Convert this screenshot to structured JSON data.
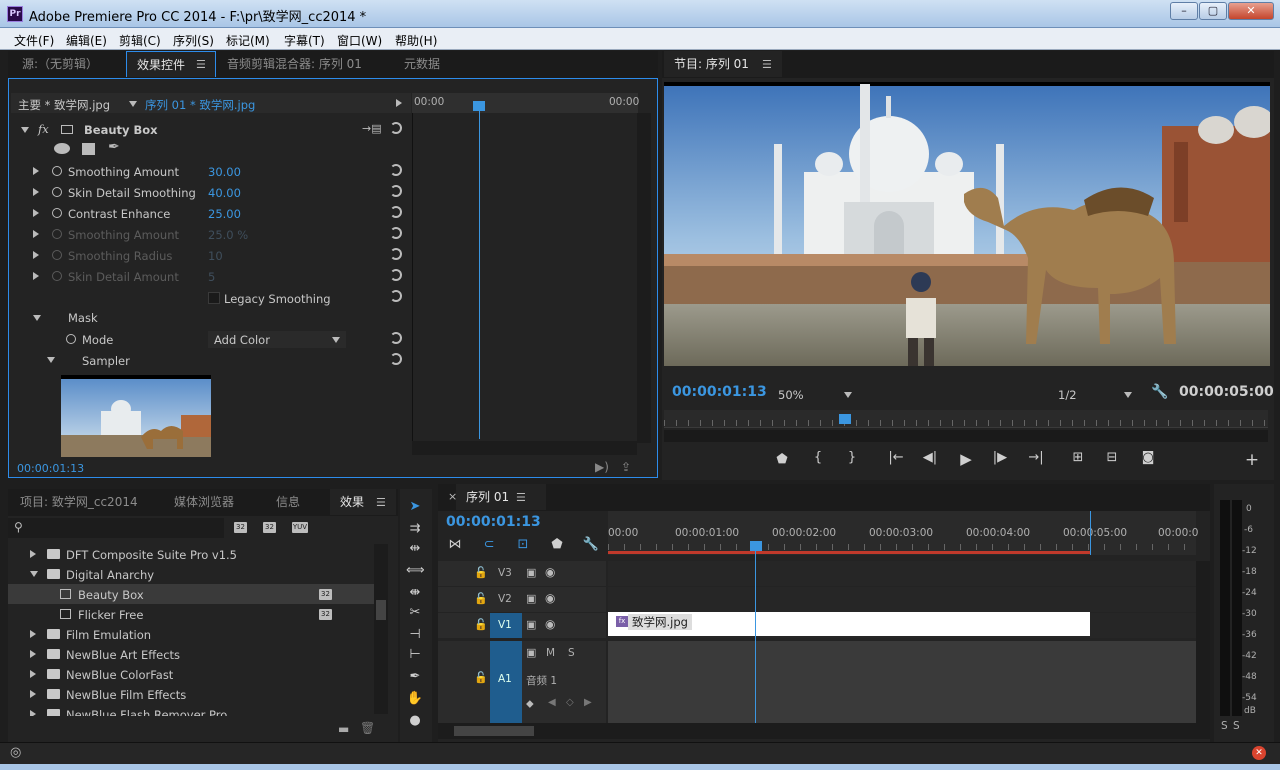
{
  "window": {
    "title": "Adobe Premiere Pro CC 2014 - F:\\pr\\致学网_cc2014 *",
    "app_badge": "Pr",
    "minimize": "–",
    "maximize": "▢",
    "close": "✕"
  },
  "menu": [
    "文件(F)",
    "编辑(E)",
    "剪辑(C)",
    "序列(S)",
    "标记(M)",
    "字幕(T)",
    "窗口(W)",
    "帮助(H)"
  ],
  "source_panel": {
    "tabs": [
      "源:（无剪辑）",
      "效果控件",
      "音频剪辑混合器: 序列 01",
      "元数据"
    ],
    "active_tab": "效果控件",
    "master_clip": "主要 * 致学网.jpg",
    "sequence_clip": "序列 01 * 致学网.jpg",
    "ruler_start": "00:00",
    "ruler_end": "00:00",
    "effect_name": "Beauty Box",
    "fx_label": "fx",
    "params": [
      {
        "name": "Smoothing Amount",
        "value": "30.00",
        "enabled": true
      },
      {
        "name": "Skin Detail Smoothing",
        "value": "40.00",
        "enabled": true
      },
      {
        "name": "Contrast Enhance",
        "value": "25.00",
        "enabled": true
      },
      {
        "name": "Smoothing Amount",
        "value": "25.0 %",
        "enabled": false
      },
      {
        "name": "Smoothing Radius",
        "value": "10",
        "enabled": false
      },
      {
        "name": "Skin Detail Amount",
        "value": "5",
        "enabled": false
      }
    ],
    "legacy_smoothing": "Legacy Smoothing",
    "mask_label": "Mask",
    "mode_label": "Mode",
    "mode_value": "Add Color",
    "sampler_label": "Sampler",
    "timecode": "00:00:01:13"
  },
  "program_monitor": {
    "tab": "节目: 序列 01",
    "timecode": "00:00:01:13",
    "zoom": "50%",
    "resolution": "1/2",
    "duration": "00:00:05:00",
    "playhead_fraction": 0.3,
    "controls": [
      "marker-icon",
      "in-point-icon",
      "out-point-icon",
      "go-to-in-icon",
      "step-back-icon",
      "play-icon",
      "step-forward-icon",
      "go-to-out-icon",
      "lift-icon",
      "extract-icon",
      "export-frame-icon"
    ]
  },
  "project_panel": {
    "tabs": [
      "项目: 致学网_cc2014",
      "媒体浏览器",
      "信息",
      "效果"
    ],
    "active_tab": "效果",
    "search_placeholder": "",
    "badges": [
      "32",
      "32",
      "YUV"
    ],
    "items": [
      {
        "label": "DFT Composite Suite Pro v1.5",
        "type": "folder",
        "expanded": false,
        "indent": 0
      },
      {
        "label": "Digital Anarchy",
        "type": "folder",
        "expanded": true,
        "indent": 0
      },
      {
        "label": "Beauty Box",
        "type": "effect",
        "indent": 1,
        "selected": true
      },
      {
        "label": "Flicker Free",
        "type": "effect",
        "indent": 1
      },
      {
        "label": "Film Emulation",
        "type": "folder",
        "expanded": false,
        "indent": 0
      },
      {
        "label": "NewBlue Art Effects",
        "type": "folder",
        "expanded": false,
        "indent": 0
      },
      {
        "label": "NewBlue ColorFast",
        "type": "folder",
        "expanded": false,
        "indent": 0
      },
      {
        "label": "NewBlue Film Effects",
        "type": "folder",
        "expanded": false,
        "indent": 0
      },
      {
        "label": "NewBlue Flash Remover Pro",
        "type": "folder",
        "expanded": false,
        "indent": 0
      }
    ]
  },
  "timeline": {
    "tab": "序列 01",
    "timecode": "00:00:01:13",
    "ruler": [
      "00:00",
      "00:00:01:00",
      "00:00:02:00",
      "00:00:03:00",
      "00:00:04:00",
      "00:00:05:00",
      "00:00:0"
    ],
    "tracks": {
      "v3": "V3",
      "v2": "V2",
      "v1": "V1",
      "a1": "A1",
      "a1_name": "音频 1",
      "mute": "M",
      "solo": "S"
    },
    "clip_name": "致学网.jpg"
  },
  "audio_meter": {
    "scale": [
      "0",
      "-6",
      "-12",
      "-18",
      "-24",
      "-30",
      "-36",
      "-42",
      "-48",
      "-54",
      "dB"
    ],
    "solo_labels": [
      "S",
      "S"
    ]
  },
  "colors": {
    "accent": "#2d8ceb",
    "timecode": "#3b96e0",
    "clip": "#ffffff",
    "track_select": "#1f5d8e"
  }
}
